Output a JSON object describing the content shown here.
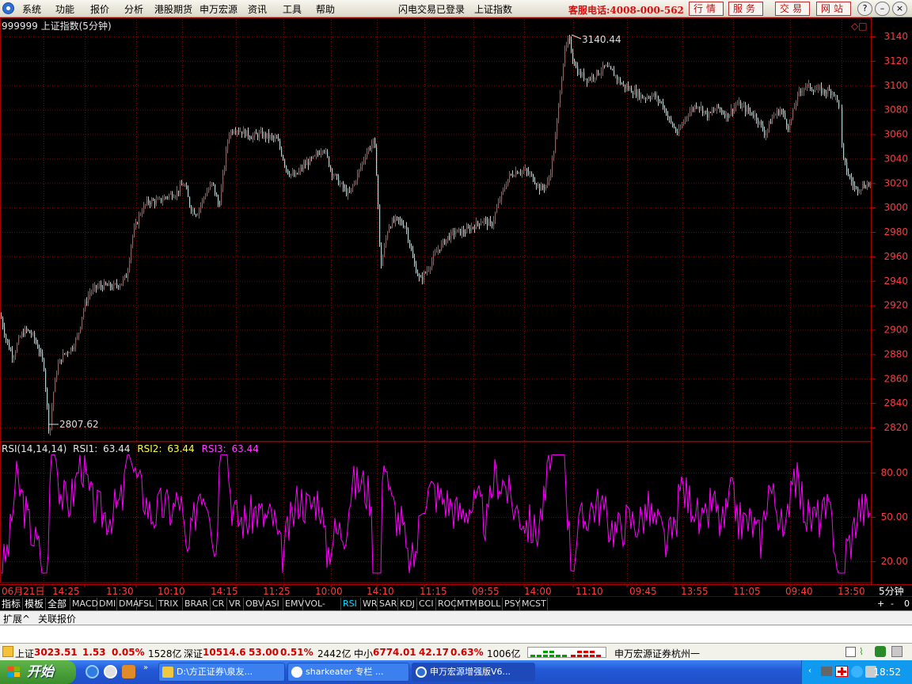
{
  "menubar": {
    "items": [
      "系统",
      "功能",
      "报价",
      "分析",
      "港股期货",
      "申万宏源",
      "资讯",
      "工具",
      "帮助"
    ],
    "status": "闪电交易已登录",
    "index_name": "上证指数",
    "hotline": "客服电话:4008-000-562",
    "nav_buttons": [
      "行情",
      "服务",
      "交易",
      "网站"
    ]
  },
  "chart": {
    "title": "999999 上证指数(5分钟)",
    "high_label": "3140.44",
    "low_label": "2807.62",
    "y_ticks": [
      "3140",
      "3120",
      "3100",
      "3080",
      "3060",
      "3040",
      "3020",
      "3000",
      "2980",
      "2960",
      "2940",
      "2920",
      "2900",
      "2880",
      "2860",
      "2840",
      "2820"
    ],
    "rsi_label": "RSI(14,14,14)",
    "rsi1_label": "RSI1:",
    "rsi1_value": "63.44",
    "rsi2_label": "RSI2:",
    "rsi2_value": "63.44",
    "rsi3_label": "RSI3:",
    "rsi3_value": "63.44",
    "rsi_ticks": [
      "80.00",
      "50.00",
      "20.00"
    ],
    "time_labels": [
      "06月21日",
      "14:25",
      "11:30",
      "10:10",
      "14:15",
      "11:25",
      "10:00",
      "14:10",
      "11:15",
      "09:55",
      "14:00",
      "11:10",
      "09:45",
      "13:55",
      "11:05",
      "09:40",
      "13:50"
    ],
    "period": "5分钟",
    "colors": {
      "up": "#ff3333",
      "down": "#54ffff",
      "rsi": "#ff00ff",
      "grid": "#7a0000",
      "axis_text": "#ff3c3c"
    }
  },
  "chart_data": {
    "type": "candlestick",
    "title": "999999 上证指数(5分钟)",
    "ylim": [
      2800,
      3145
    ],
    "annotations": [
      {
        "label": "3140.44",
        "value": 3140.44
      },
      {
        "label": "2807.62",
        "value": 2807.62
      }
    ],
    "price_path": [
      [
        0,
        2912
      ],
      [
        8,
        2890
      ],
      [
        16,
        2878
      ],
      [
        24,
        2893
      ],
      [
        32,
        2900
      ],
      [
        40,
        2896
      ],
      [
        48,
        2885
      ],
      [
        55,
        2870
      ],
      [
        62,
        2812
      ],
      [
        66,
        2845
      ],
      [
        72,
        2870
      ],
      [
        80,
        2880
      ],
      [
        90,
        2885
      ],
      [
        98,
        2895
      ],
      [
        104,
        2915
      ],
      [
        112,
        2930
      ],
      [
        122,
        2935
      ],
      [
        132,
        2936
      ],
      [
        142,
        2935
      ],
      [
        152,
        2938
      ],
      [
        160,
        2945
      ],
      [
        166,
        2975
      ],
      [
        176,
        2995
      ],
      [
        186,
        3005
      ],
      [
        200,
        3005
      ],
      [
        212,
        3010
      ],
      [
        222,
        3012
      ],
      [
        232,
        3020
      ],
      [
        240,
        3000
      ],
      [
        248,
        2995
      ],
      [
        258,
        3010
      ],
      [
        268,
        3020
      ],
      [
        276,
        3000
      ],
      [
        282,
        3030
      ],
      [
        288,
        3060
      ],
      [
        296,
        3065
      ],
      [
        306,
        3062
      ],
      [
        318,
        3058
      ],
      [
        328,
        3060
      ],
      [
        338,
        3058
      ],
      [
        350,
        3055
      ],
      [
        362,
        3030
      ],
      [
        372,
        3025
      ],
      [
        384,
        3035
      ],
      [
        396,
        3040
      ],
      [
        408,
        3050
      ],
      [
        418,
        3030
      ],
      [
        428,
        3020
      ],
      [
        440,
        3010
      ],
      [
        450,
        3025
      ],
      [
        462,
        3045
      ],
      [
        472,
        3055
      ],
      [
        476,
        3020
      ],
      [
        480,
        2950
      ],
      [
        490,
        2985
      ],
      [
        500,
        2990
      ],
      [
        512,
        2985
      ],
      [
        522,
        2955
      ],
      [
        530,
        2940
      ],
      [
        540,
        2950
      ],
      [
        552,
        2965
      ],
      [
        564,
        2975
      ],
      [
        574,
        2980
      ],
      [
        586,
        2980
      ],
      [
        598,
        2985
      ],
      [
        610,
        2990
      ],
      [
        620,
        2985
      ],
      [
        630,
        3005
      ],
      [
        642,
        3025
      ],
      [
        652,
        3030
      ],
      [
        662,
        3030
      ],
      [
        672,
        3025
      ],
      [
        682,
        3015
      ],
      [
        692,
        3020
      ],
      [
        700,
        3050
      ],
      [
        706,
        3090
      ],
      [
        712,
        3125
      ],
      [
        718,
        3138
      ],
      [
        724,
        3120
      ],
      [
        730,
        3110
      ],
      [
        742,
        3105
      ],
      [
        754,
        3110
      ],
      [
        764,
        3115
      ],
      [
        774,
        3110
      ],
      [
        786,
        3100
      ],
      [
        800,
        3095
      ],
      [
        812,
        3090
      ],
      [
        824,
        3092
      ],
      [
        836,
        3085
      ],
      [
        846,
        3070
      ],
      [
        856,
        3060
      ],
      [
        866,
        3075
      ],
      [
        880,
        3085
      ],
      [
        894,
        3075
      ],
      [
        906,
        3082
      ],
      [
        918,
        3075
      ],
      [
        930,
        3085
      ],
      [
        942,
        3080
      ],
      [
        954,
        3075
      ],
      [
        966,
        3060
      ],
      [
        976,
        3075
      ],
      [
        986,
        3080
      ],
      [
        996,
        3065
      ],
      [
        1006,
        3090
      ],
      [
        1016,
        3100
      ],
      [
        1028,
        3097
      ],
      [
        1040,
        3095
      ],
      [
        1052,
        3095
      ],
      [
        1060,
        3082
      ],
      [
        1064,
        3040
      ],
      [
        1072,
        3025
      ],
      [
        1080,
        3015
      ],
      [
        1090,
        3018
      ],
      [
        1100,
        3020
      ]
    ],
    "rsi_period": [
      14,
      14,
      14
    ],
    "rsi_last": [
      63.44,
      63.44,
      63.44
    ],
    "rsi_ylim": [
      0,
      100
    ]
  },
  "tabs": [
    "指标",
    "模板",
    "全部",
    "MACD",
    "DMI",
    "DMA",
    "FSL",
    "TRIX",
    "BRAR",
    "CR",
    "VR",
    "OBV",
    "ASI",
    "EMV",
    "VOL-TDX",
    "RSI",
    "WR",
    "SAR",
    "KDJ",
    "CCI",
    "ROC",
    "MTM",
    "BOLL",
    "PSY",
    "MCST"
  ],
  "tab_selected": "RSI",
  "tab_controls": [
    "+",
    "-",
    "0"
  ],
  "expand": {
    "expand_label": "扩展^",
    "linked_label": "关联报价"
  },
  "ticker": {
    "sh_label": "上证",
    "sh_value": "3023.51",
    "sh_change": "1.53",
    "sh_pct": "0.05%",
    "sh_amount": "1528亿",
    "sz_label": "深证",
    "sz_value": "10514.6",
    "sz_change": "53.00",
    "sz_pct": "0.51%",
    "sz_amount": "2442亿",
    "zx_label": "中小",
    "zx_value": "6774.01",
    "zx_change": "42.17",
    "zx_pct": "0.63%",
    "zx_amount": "1006亿",
    "broker": "申万宏源证券杭州一"
  },
  "taskbar": {
    "start": "开始",
    "windows": [
      "D:\\方正证券\\泉友...",
      "sharkeater 专栏 ...",
      "申万宏源增强版V6..."
    ],
    "clock": "18:52"
  }
}
